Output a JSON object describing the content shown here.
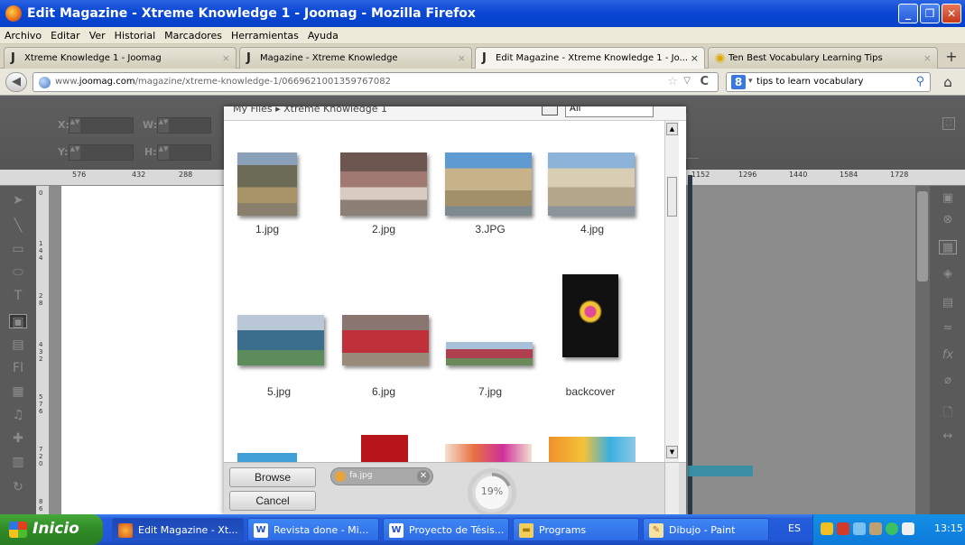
{
  "window": {
    "title": "Edit Magazine - Xtreme Knowledge 1 - Joomag - Mozilla Firefox",
    "minimize": "_",
    "maximize": "❐",
    "close": "✕"
  },
  "menu": [
    "Archivo",
    "Editar",
    "Ver",
    "Historial",
    "Marcadores",
    "Herramientas",
    "Ayuda"
  ],
  "tabs": [
    {
      "label": "Xtreme Knowledge 1 - Joomag",
      "icon": "joomag-icon",
      "close": "×"
    },
    {
      "label": "Magazine - Xtreme Knowledge",
      "icon": "joomag-icon",
      "close": "×"
    },
    {
      "label": "Edit Magazine - Xtreme Knowledge 1 - Jo...",
      "icon": "joomag-icon",
      "close": "×",
      "active": true
    },
    {
      "label": "Ten Best Vocabulary Learning Tips",
      "icon": "vocab-site-icon",
      "close": "×"
    }
  ],
  "newtab": "+",
  "nav": {
    "url_prefix": "www.",
    "url_domain": "joomag.com",
    "url_path": "/magazine/xtreme-knowledge-1/0669621001359767082",
    "search_text": "tips to learn vocabulary",
    "search_engine": "8"
  },
  "props": {
    "x_label": "X:",
    "y_label": "Y:",
    "w_label": "W:",
    "h_label": "H:"
  },
  "ruler": [
    "576",
    "432",
    "288",
    "1152",
    "1296",
    "1440",
    "1584",
    "1728"
  ],
  "vruler": [
    "0",
    "1",
    "4",
    "4",
    "2",
    "8",
    "4",
    "3",
    "2",
    "5",
    "7",
    "6",
    "7",
    "2",
    "0",
    "8",
    "6"
  ],
  "dialog": {
    "breadcrumb": "My Files  ▸  Xtreme Knowledge 1",
    "filter": "All",
    "files": [
      {
        "name": "1.jpg"
      },
      {
        "name": "2.jpg"
      },
      {
        "name": "3.JPG"
      },
      {
        "name": "4.jpg"
      },
      {
        "name": "5.jpg"
      },
      {
        "name": "6.jpg"
      },
      {
        "name": "7.jpg"
      },
      {
        "name": "backcover"
      }
    ],
    "browse": "Browse",
    "cancel": "Cancel",
    "upload_file": "fa.jpg",
    "progress_text": "19%",
    "progress": 0.19
  },
  "taskbar": {
    "start": "Inicio",
    "tasks": [
      {
        "label": "Edit Magazine - Xt...",
        "icon": "firefox-icon"
      },
      {
        "label": "Revista done - Mi...",
        "icon": "word-icon"
      },
      {
        "label": "Proyecto de Tésis...",
        "icon": "word-icon"
      },
      {
        "label": "Programs",
        "icon": "folder-icon"
      },
      {
        "label": "Dibujo - Paint",
        "icon": "paint-icon"
      }
    ],
    "lang": "ES",
    "clock": "13:15"
  }
}
